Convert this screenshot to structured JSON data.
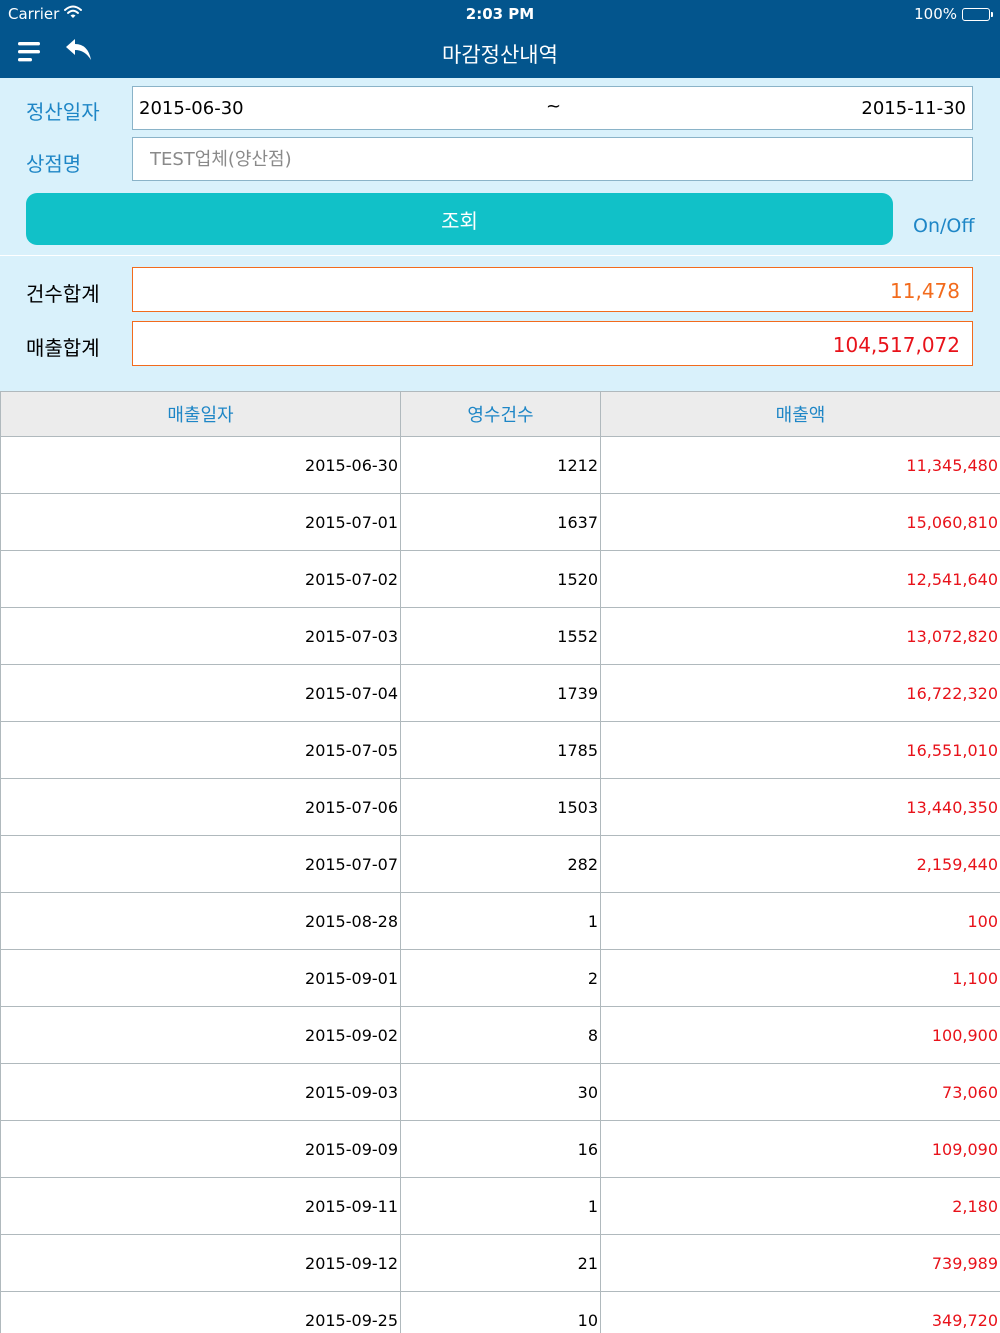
{
  "status_bar": {
    "carrier": "Carrier",
    "time": "2:03 PM",
    "battery": "100%"
  },
  "header": {
    "title": "마감정산내역",
    "menu_icon": "menu-icon",
    "back_icon": "back-arrow-icon",
    "background_color": "#03558d"
  },
  "filter": {
    "date_label": "정산일자",
    "date_start": "2015-06-30",
    "date_separator": "~",
    "date_end": "2015-11-30",
    "store_label": "상점명",
    "store_placeholder": "TEST업체(양산점)",
    "search_button": "조회",
    "toggle_link": "On/Off",
    "accent_color": "#11c1c8"
  },
  "summary": {
    "count_label": "건수합계",
    "count_value": "11,478",
    "sales_label": "매출합계",
    "sales_value": "104,517,072",
    "count_color": "#f26b1d",
    "sales_color": "#e8121a"
  },
  "table": {
    "headers": [
      "매출일자",
      "영수건수",
      "매출액"
    ],
    "rows": [
      {
        "date": "2015-06-30",
        "count": "1212",
        "amount": "11,345,480"
      },
      {
        "date": "2015-07-01",
        "count": "1637",
        "amount": "15,060,810"
      },
      {
        "date": "2015-07-02",
        "count": "1520",
        "amount": "12,541,640"
      },
      {
        "date": "2015-07-03",
        "count": "1552",
        "amount": "13,072,820"
      },
      {
        "date": "2015-07-04",
        "count": "1739",
        "amount": "16,722,320"
      },
      {
        "date": "2015-07-05",
        "count": "1785",
        "amount": "16,551,010"
      },
      {
        "date": "2015-07-06",
        "count": "1503",
        "amount": "13,440,350"
      },
      {
        "date": "2015-07-07",
        "count": "282",
        "amount": "2,159,440"
      },
      {
        "date": "2015-08-28",
        "count": "1",
        "amount": "100"
      },
      {
        "date": "2015-09-01",
        "count": "2",
        "amount": "1,100"
      },
      {
        "date": "2015-09-02",
        "count": "8",
        "amount": "100,900"
      },
      {
        "date": "2015-09-03",
        "count": "30",
        "amount": "73,060"
      },
      {
        "date": "2015-09-09",
        "count": "16",
        "amount": "109,090"
      },
      {
        "date": "2015-09-11",
        "count": "1",
        "amount": "2,180"
      },
      {
        "date": "2015-09-12",
        "count": "21",
        "amount": "739,989"
      },
      {
        "date": "2015-09-25",
        "count": "10",
        "amount": "349,720"
      }
    ]
  }
}
